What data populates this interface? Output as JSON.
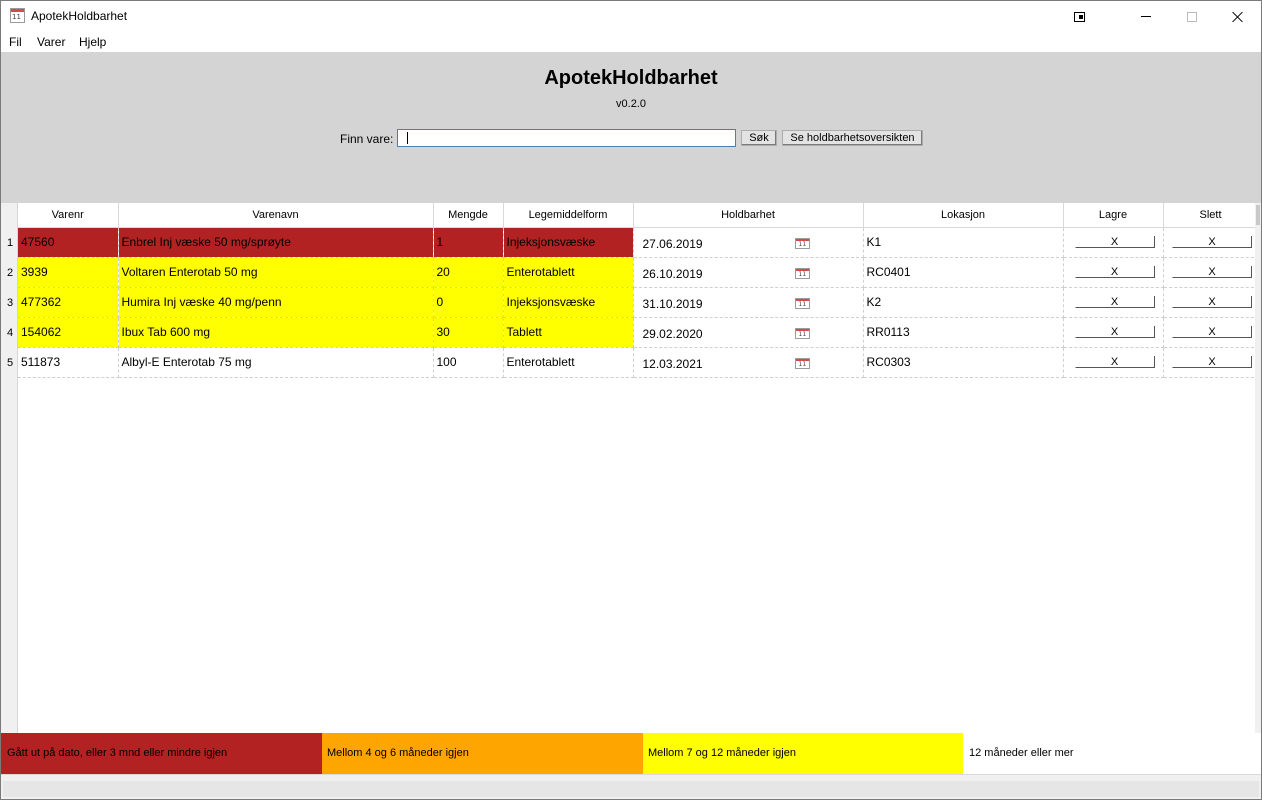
{
  "window": {
    "title": "ApotekHoldbarhet",
    "icon": "calendar-icon",
    "icon_number": "11"
  },
  "menu": {
    "items": [
      "Fil",
      "Varer",
      "Hjelp"
    ]
  },
  "header": {
    "title": "ApotekHoldbarhet",
    "version": "v0.2.0",
    "search_label": "Finn vare:",
    "search_value": "",
    "search_button": "Søk",
    "overview_button": "Se holdbarhetsoversikten"
  },
  "table": {
    "columns": [
      "Varenr",
      "Varenavn",
      "Mengde",
      "Legemiddelform",
      "Holdbarhet",
      "Lokasjon",
      "Lagre",
      "Slett"
    ],
    "rows": [
      {
        "num": "1",
        "varenr": "47560",
        "varenavn": "Enbrel Inj væske 50 mg/sprøyte",
        "mengde": "1",
        "form": "Injeksjonsvæske",
        "holdbarhet": "27.06.2019",
        "lokasjon": "K1",
        "lagre": "X",
        "slett": "X",
        "status": "red"
      },
      {
        "num": "2",
        "varenr": "3939",
        "varenavn": "Voltaren Enterotab 50 mg",
        "mengde": "20",
        "form": "Enterotablett",
        "holdbarhet": "26.10.2019",
        "lokasjon": "RC0401",
        "lagre": "X",
        "slett": "X",
        "status": "yellow"
      },
      {
        "num": "3",
        "varenr": "477362",
        "varenavn": "Humira Inj væske 40 mg/penn",
        "mengde": "0",
        "form": "Injeksjonsvæske",
        "holdbarhet": "31.10.2019",
        "lokasjon": "K2",
        "lagre": "X",
        "slett": "X",
        "status": "yellow"
      },
      {
        "num": "4",
        "varenr": "154062",
        "varenavn": "Ibux Tab 600 mg",
        "mengde": "30",
        "form": "Tablett",
        "holdbarhet": "29.02.2020",
        "lokasjon": "RR0113",
        "lagre": "X",
        "slett": "X",
        "status": "yellow"
      },
      {
        "num": "5",
        "varenr": "511873",
        "varenavn": "Albyl-E Enterotab 75 mg",
        "mengde": "100",
        "form": "Enterotablett",
        "holdbarhet": "12.03.2021",
        "lokasjon": "RC0303",
        "lagre": "X",
        "slett": "X",
        "status": "none"
      }
    ],
    "calendar_icon_number": "11"
  },
  "legend": {
    "red": "Gått ut på dato, eller 3 mnd eller mindre igjen",
    "orange": "Mellom 4 og 6 måneder igjen",
    "yellow": "Mellom 7 og 12 måneder igjen",
    "white": "12 måneder eller mer"
  },
  "colors": {
    "red": "#b22222",
    "orange": "#ffa500",
    "yellow": "#ffff00",
    "header_bg": "#d4d4d4"
  }
}
